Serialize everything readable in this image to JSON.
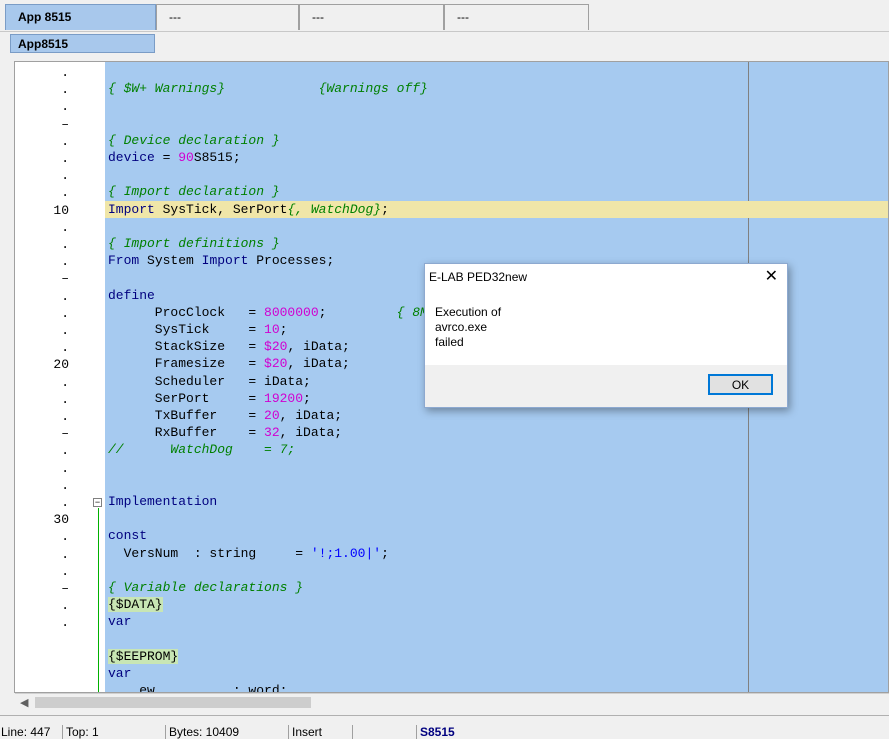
{
  "tabs": [
    {
      "label": "App 8515",
      "active": true
    },
    {
      "label": "---"
    },
    {
      "label": "---"
    },
    {
      "label": "---"
    }
  ],
  "subtab": {
    "label": "App8515"
  },
  "editor": {
    "line_markers": [
      ".",
      ".",
      ".",
      "–",
      ".",
      ".",
      ".",
      ".",
      "10",
      ".",
      ".",
      ".",
      "–",
      ".",
      ".",
      ".",
      ".",
      "20",
      ".",
      ".",
      ".",
      "–",
      ".",
      ".",
      ".",
      ".",
      "30",
      ".",
      ".",
      ".",
      "–",
      ".",
      "."
    ],
    "lines": [
      [],
      [
        {
          "t": "{ $W+ Warnings}            {Warnings off}",
          "c": "cm"
        }
      ],
      [],
      [],
      [
        {
          "t": "{ Device declaration }",
          "c": "cm"
        }
      ],
      [
        {
          "t": "device",
          "c": "kw"
        },
        {
          "t": " = "
        },
        {
          "t": "90",
          "c": "num"
        },
        {
          "t": "S8515;"
        }
      ],
      [],
      [
        {
          "t": "{ Import declaration }",
          "c": "cm"
        }
      ],
      [
        {
          "t": "Import",
          "c": "kw"
        },
        {
          "t": " SysTick, SerPort"
        },
        {
          "t": "{, WatchDog}",
          "c": "cm"
        },
        {
          "t": ";"
        }
      ],
      [],
      [
        {
          "t": "{ Import definitions }",
          "c": "cm"
        }
      ],
      [
        {
          "t": "From",
          "c": "kw"
        },
        {
          "t": " System "
        },
        {
          "t": "Import",
          "c": "kw"
        },
        {
          "t": " Processes;"
        }
      ],
      [],
      [
        {
          "t": "define",
          "c": "kw"
        }
      ],
      [
        {
          "t": "      ProcClock   = "
        },
        {
          "t": "8000000",
          "c": "num"
        },
        {
          "t": ";         "
        },
        {
          "t": "{ 8M",
          "c": "cm"
        }
      ],
      [
        {
          "t": "      SysTick     = "
        },
        {
          "t": "10",
          "c": "num"
        },
        {
          "t": ";"
        }
      ],
      [
        {
          "t": "      StackSize   = "
        },
        {
          "t": "$20",
          "c": "num"
        },
        {
          "t": ", iData;"
        }
      ],
      [
        {
          "t": "      Framesize   = "
        },
        {
          "t": "$20",
          "c": "num"
        },
        {
          "t": ", iData;"
        }
      ],
      [
        {
          "t": "      Scheduler   = iData;"
        }
      ],
      [
        {
          "t": "      SerPort     = "
        },
        {
          "t": "19200",
          "c": "num"
        },
        {
          "t": ";"
        }
      ],
      [
        {
          "t": "      TxBuffer    = "
        },
        {
          "t": "20",
          "c": "num"
        },
        {
          "t": ", iData;"
        }
      ],
      [
        {
          "t": "      RxBuffer    = "
        },
        {
          "t": "32",
          "c": "num"
        },
        {
          "t": ", iData;"
        }
      ],
      [
        {
          "t": "//      WatchDog    = 7;",
          "c": "cm"
        }
      ],
      [],
      [],
      [
        {
          "t": "Implementation",
          "c": "kw"
        }
      ],
      [],
      [
        {
          "t": "const",
          "c": "kw"
        }
      ],
      [
        {
          "t": "  VersNum  : string     = "
        },
        {
          "t": "'!;1.00|'",
          "c": "str"
        },
        {
          "t": ";"
        }
      ],
      [],
      [
        {
          "t": "{ Variable declarations }",
          "c": "cm"
        }
      ],
      [
        {
          "t": "{$DATA}",
          "c": "dir"
        }
      ],
      [
        {
          "t": "var",
          "c": "kw"
        }
      ],
      [],
      [
        {
          "t": "{$EEPROM}",
          "c": "dir"
        }
      ],
      [
        {
          "t": "var",
          "c": "kw"
        }
      ],
      [
        {
          "t": "    ew          : word;"
        }
      ]
    ],
    "fold_symbol": "−"
  },
  "dialog": {
    "title": "E-LAB PED32new",
    "close": "✕",
    "message_lines": [
      "Execution of",
      "avrco.exe",
      "failed"
    ],
    "ok_label": "OK"
  },
  "status": {
    "line": "Line: 447",
    "top": "Top: 1",
    "bytes": "Bytes: 10409",
    "mode": "Insert",
    "blank": "",
    "file": "S8515"
  },
  "colors": {
    "code_bg": "#a6caf0",
    "highlight": "#f0e6a8",
    "keyword": "#00007f",
    "comment": "#008000",
    "number": "#d000d0"
  }
}
